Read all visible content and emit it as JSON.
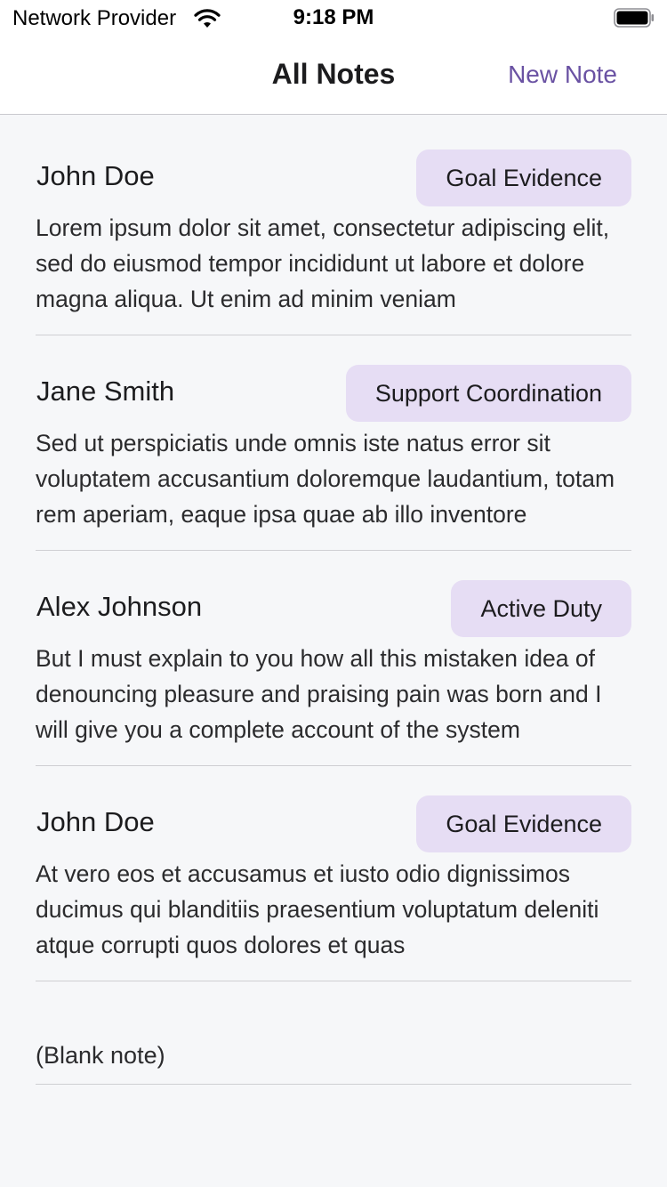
{
  "status_bar": {
    "carrier": "Network Provider",
    "time": "9:18 PM"
  },
  "nav": {
    "title": "All Notes",
    "action_label": "New Note",
    "accent_color": "#6a52a3"
  },
  "notes": [
    {
      "author": "John Doe",
      "tag": "Goal Evidence",
      "body": "Lorem ipsum dolor sit amet, consectetur adipiscing elit, sed do eiusmod tempor incididunt ut labore et dolore magna aliqua. Ut enim ad minim veniam"
    },
    {
      "author": "Jane Smith",
      "tag": "Support Coordination",
      "body": "Sed ut perspiciatis unde omnis iste natus error sit voluptatem accusantium doloremque laudantium, totam rem aperiam, eaque ipsa quae ab illo inventore"
    },
    {
      "author": "Alex Johnson",
      "tag": "Active Duty",
      "body": "But I must explain to you how all this mistaken idea of denouncing pleasure and praising pain was born and I will give you a complete account of the system"
    },
    {
      "author": "John Doe",
      "tag": "Goal Evidence",
      "body": "At vero eos et accusamus et iusto odio dignissimos ducimus qui blanditiis praesentium voluptatum deleniti atque corrupti quos dolores et quas"
    },
    {
      "body": "(Blank note)"
    }
  ],
  "colors": {
    "tag_background": "#e6ddf4",
    "page_background": "#f6f7f9"
  }
}
